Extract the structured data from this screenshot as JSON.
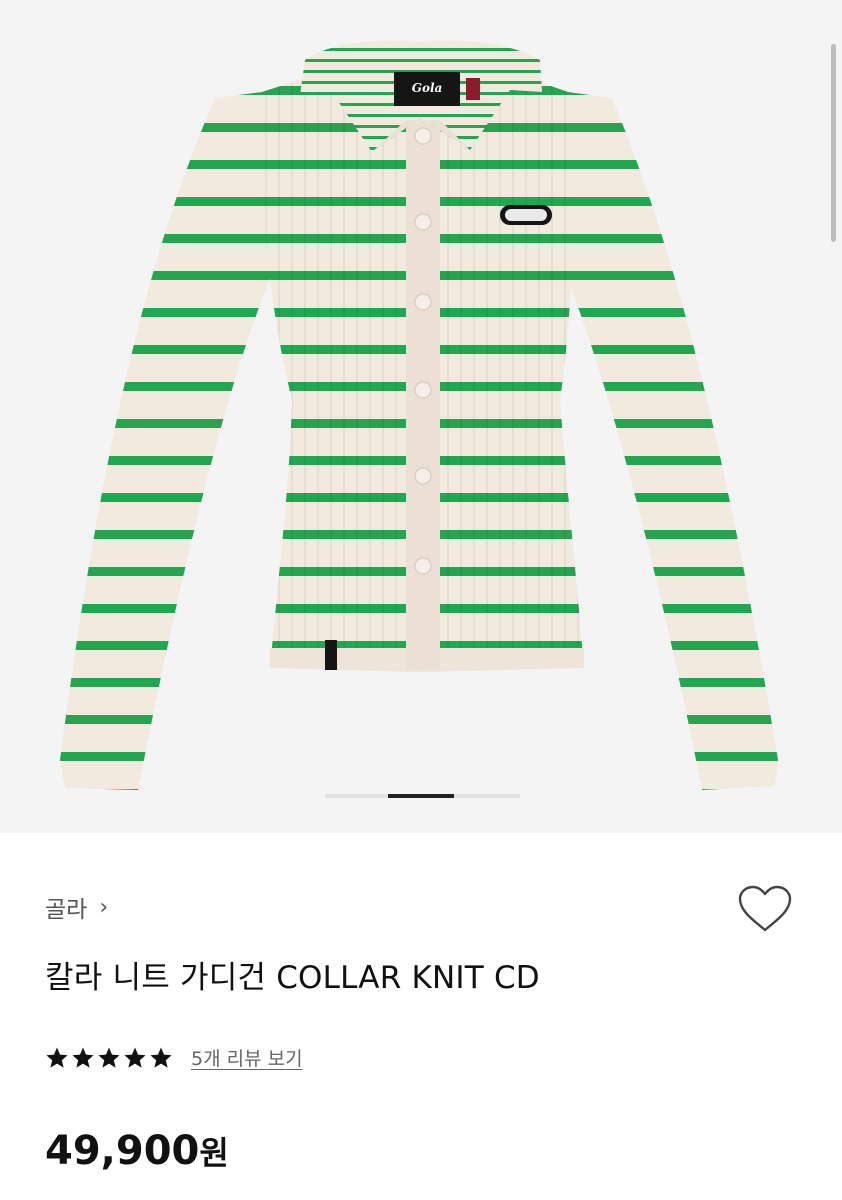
{
  "product": {
    "brand_label": "골라",
    "brand_chevron": "›",
    "title": "칼라 니트 가디건 COLLAR KNIT CD",
    "rating_stars": 5,
    "rating_max": 5,
    "reviews_link": "5개 리뷰 보기",
    "price": "49,900",
    "price_unit": "원",
    "image_logo_text": "Gola"
  },
  "colors": {
    "stripe_green": "#23a650",
    "knit_cream": "#f2e9df",
    "placket": "#ece0d6",
    "hero_bg": "#f4f4f4",
    "star": "#111111"
  },
  "icons": {
    "wishlist": "heart-outline-icon",
    "brand_nav": "chevron-right-icon",
    "rating": "star-icon"
  },
  "gallery": {
    "total_slides": 3,
    "current_slide": 2
  }
}
